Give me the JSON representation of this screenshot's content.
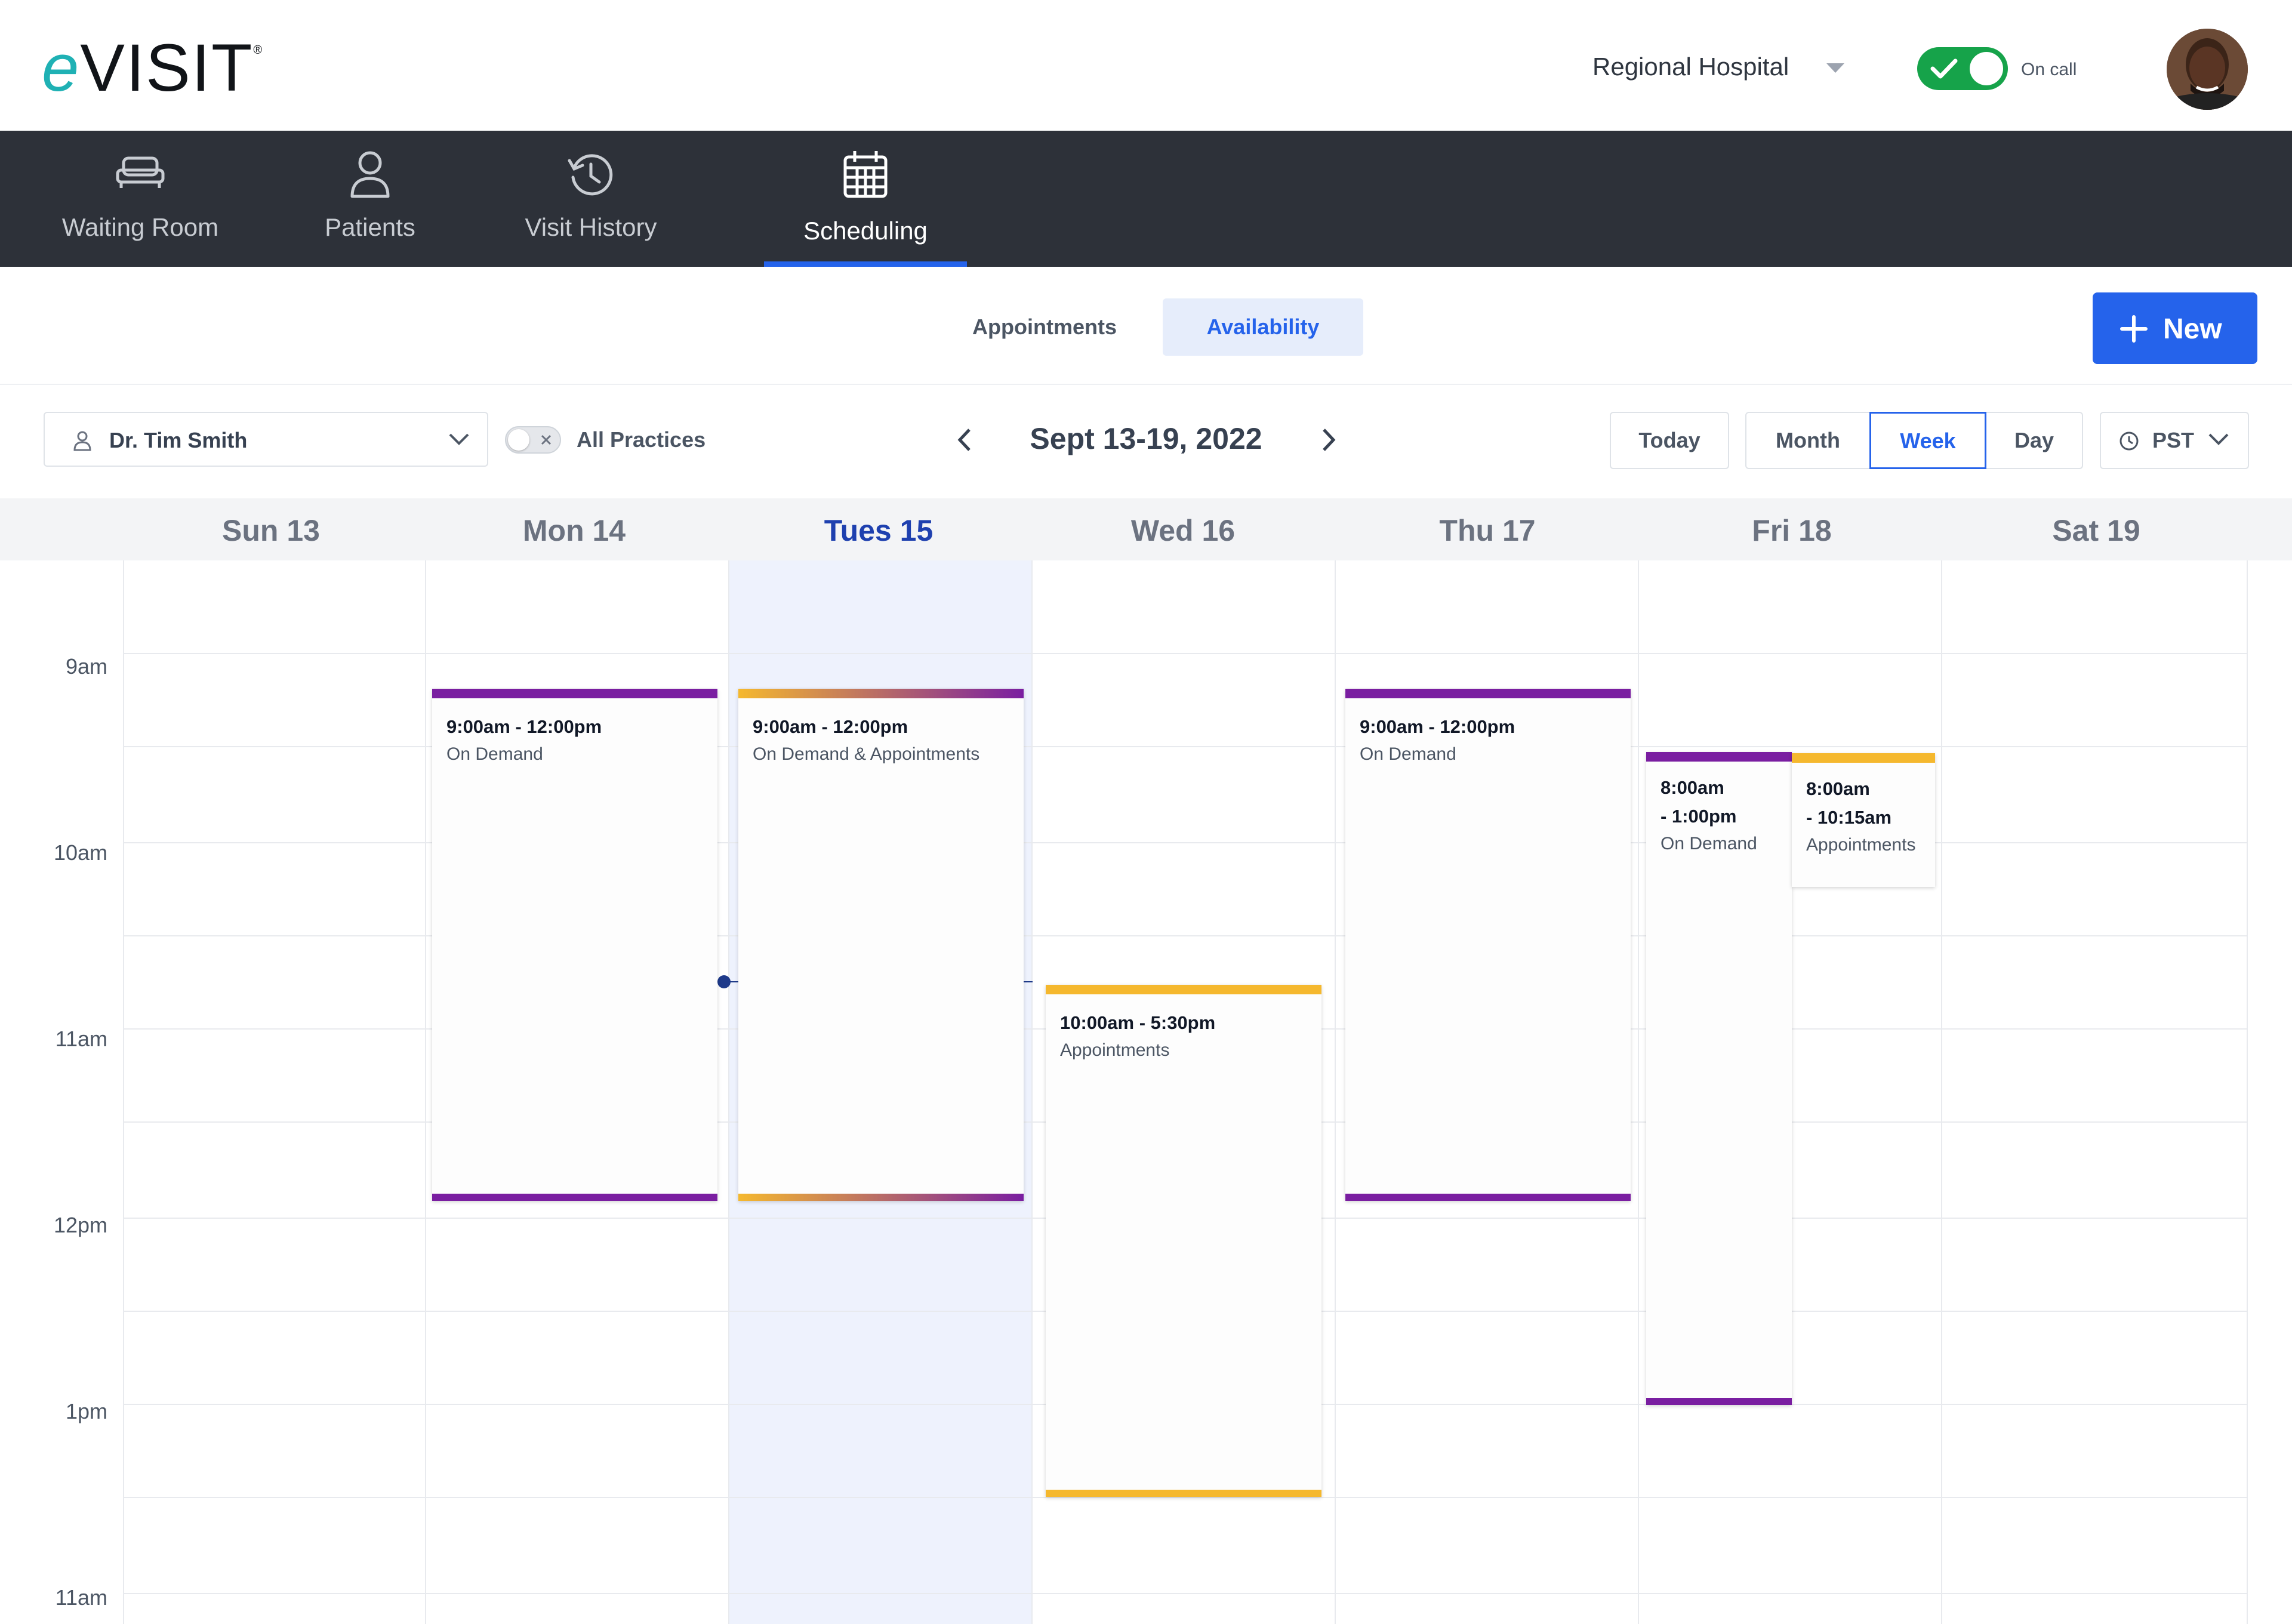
{
  "header": {
    "logo_text": "eVisit",
    "hospital": "Regional Hospital",
    "on_call_label": "On call",
    "on_call": true
  },
  "nav": {
    "items": [
      {
        "label": "Waiting Room",
        "icon": "couch-icon"
      },
      {
        "label": "Patients",
        "icon": "person-icon"
      },
      {
        "label": "Visit History",
        "icon": "history-icon"
      },
      {
        "label": "Scheduling",
        "icon": "calendar-icon",
        "active": true
      }
    ]
  },
  "subtabs": {
    "appointments": "Appointments",
    "availability": "Availability",
    "active": "Availability"
  },
  "new_button": "New",
  "toolbar": {
    "provider": "Dr. Tim Smith",
    "all_practices": "All Practices",
    "all_practices_on": false,
    "date_range": "Sept 13-19, 2022",
    "today": "Today",
    "month": "Month",
    "week": "Week",
    "day": "Day",
    "view_selected": "Week",
    "timezone": "PST"
  },
  "calendar": {
    "days": [
      "Sun 13",
      "Mon 14",
      "Tues 15",
      "Wed 16",
      "Thu 17",
      "Fri 18",
      "Sat 19"
    ],
    "today_index": 2,
    "time_labels": [
      "9am",
      "10am",
      "11am",
      "12pm",
      "1pm",
      "11am"
    ],
    "events": {
      "mon": {
        "time": "9:00am - 12:00pm",
        "type": "On Demand"
      },
      "tue": {
        "time": "9:00am - 12:00pm",
        "type": "On Demand & Appointments"
      },
      "wed": {
        "time": "10:00am - 5:30pm",
        "type": "Appointments"
      },
      "thu": {
        "time": "9:00am - 12:00pm",
        "type": "On Demand"
      },
      "fri_a": {
        "time_line1": "8:00am",
        "time_line2": "- 1:00pm",
        "type": "On Demand"
      },
      "fri_b": {
        "time_line1": "8:00am",
        "time_line2": "- 10:15am",
        "type": "Appointments"
      }
    }
  },
  "colors": {
    "accent": "#2563eb",
    "nav_bg": "#2d3139",
    "on_demand": "#7a1ea1",
    "appointments": "#f5b82e",
    "on_call_green": "#16a34a"
  }
}
